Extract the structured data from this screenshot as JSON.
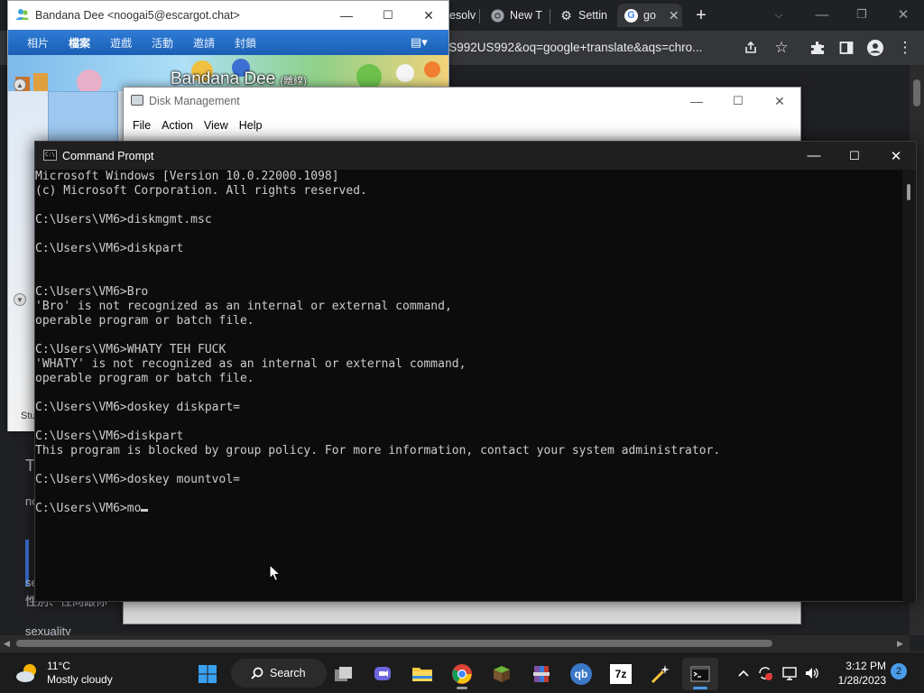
{
  "chrome": {
    "tabs": [
      {
        "label": "esolv",
        "icon": "resolve-favicon-icon",
        "active": false
      },
      {
        "label": "New T",
        "icon": "chrome-icon",
        "active": false
      },
      {
        "label": "Settin",
        "icon": "gear-icon",
        "active": false
      },
      {
        "label": "go",
        "icon": "google-icon",
        "active": true
      }
    ],
    "tab_close": "✕",
    "new_tab": "+",
    "address": "nUS992US992&oq=google+translate&aqs=chro...",
    "page_texts": [
      "T",
      "no",
      "se",
      "性別、性向跟你",
      "sexuality"
    ]
  },
  "messenger": {
    "title": "Bandana Dee <noogai5@escargot.chat>",
    "menu": [
      "相片",
      "檔案",
      "遊戲",
      "活動",
      "邀請",
      "封鎖"
    ],
    "active_menu_index": 1,
    "display_name": "Bandana Dee",
    "status": "(離線)",
    "footer_text": "Stu"
  },
  "diskmgmt": {
    "title": "Disk Management",
    "menu": [
      "File",
      "Action",
      "View",
      "Help"
    ]
  },
  "cmd": {
    "title": "Command Prompt",
    "lines": [
      "Microsoft Windows [Version 10.0.22000.1098]",
      "(c) Microsoft Corporation. All rights reserved.",
      "",
      "C:\\Users\\VM6>diskmgmt.msc",
      "",
      "C:\\Users\\VM6>diskpart",
      "",
      "",
      "C:\\Users\\VM6>Bro",
      "'Bro' is not recognized as an internal or external command,",
      "operable program or batch file.",
      "",
      "C:\\Users\\VM6>WHATY TEH FUCK",
      "'WHATY' is not recognized as an internal or external command,",
      "operable program or batch file.",
      "",
      "C:\\Users\\VM6>doskey diskpart=",
      "",
      "C:\\Users\\VM6>diskpart",
      "This program is blocked by group policy. For more information, contact your system administrator.",
      "",
      "C:\\Users\\VM6>doskey mountvol=",
      "",
      "C:\\Users\\VM6>mo"
    ]
  },
  "taskbar": {
    "weather_temp": "11°C",
    "weather_cond": "Mostly cloudy",
    "search_label": "Search",
    "time": "3:12 PM",
    "date": "1/28/2023",
    "notification_count": "2",
    "pinned": [
      "start-icon",
      "task-view-icon",
      "teams-chat-icon",
      "file-explorer-icon",
      "chrome-icon",
      "minecraft-icon",
      "winrar-icon",
      "qbittorrent-icon",
      "7zip-icon",
      "magic-wand-app-icon",
      "terminal-icon"
    ],
    "seven_zip_label": "7z",
    "qbit_label": "qb"
  }
}
